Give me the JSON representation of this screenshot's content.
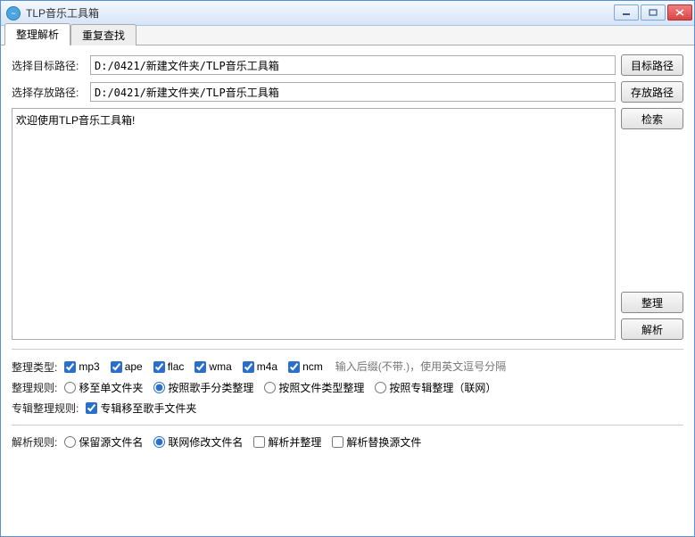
{
  "title": "TLP音乐工具箱",
  "tabs": [
    {
      "label": "整理解析",
      "active": true
    },
    {
      "label": "重复查找",
      "active": false
    }
  ],
  "path_target": {
    "label": "选择目标路径:",
    "value": "D:/0421/新建文件夹/TLP音乐工具箱",
    "button": "目标路径"
  },
  "path_save": {
    "label": "选择存放路径:",
    "value": "D:/0421/新建文件夹/TLP音乐工具箱",
    "button": "存放路径"
  },
  "log_text": "欢迎使用TLP音乐工具箱!",
  "buttons": {
    "search": "检索",
    "organize": "整理",
    "parse": "解析"
  },
  "type_row": {
    "label": "整理类型:",
    "items": [
      {
        "label": "mp3",
        "checked": true
      },
      {
        "label": "ape",
        "checked": true
      },
      {
        "label": "flac",
        "checked": true
      },
      {
        "label": "wma",
        "checked": true
      },
      {
        "label": "m4a",
        "checked": true
      },
      {
        "label": "ncm",
        "checked": true
      }
    ],
    "suffix_placeholder": "输入后缀(不带.)，使用英文逗号分隔"
  },
  "rule_row": {
    "label": "整理规则:",
    "items": [
      {
        "label": "移至单文件夹",
        "checked": false
      },
      {
        "label": "按照歌手分类整理",
        "checked": true
      },
      {
        "label": "按照文件类型整理",
        "checked": false
      },
      {
        "label": "按照专辑整理（联网）",
        "checked": false
      }
    ]
  },
  "album_row": {
    "label": "专辑整理规则:",
    "items": [
      {
        "label": "专辑移至歌手文件夹",
        "checked": true
      }
    ]
  },
  "parse_row": {
    "label": "解析规则:",
    "radios": [
      {
        "label": "保留源文件名",
        "checked": false
      },
      {
        "label": "联网修改文件名",
        "checked": true
      }
    ],
    "checks": [
      {
        "label": "解析并整理",
        "checked": false
      },
      {
        "label": "解析替换源文件",
        "checked": false
      }
    ]
  }
}
